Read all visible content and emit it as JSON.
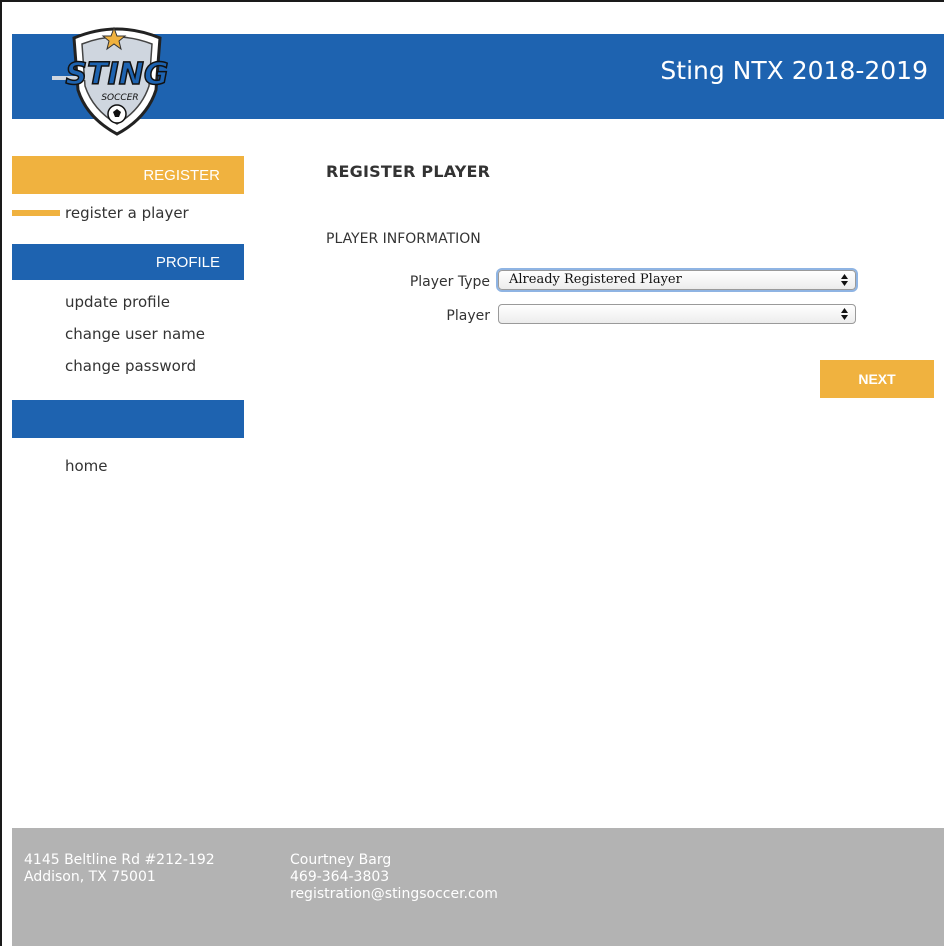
{
  "header": {
    "logo_alt": "Sting Soccer logo",
    "logo_text": "STING",
    "logo_subtext": "SOCCER",
    "site_title": "Sting NTX 2018-2019"
  },
  "sidebar": {
    "register_header": "REGISTER",
    "register_links": [
      "register a player"
    ],
    "profile_header": "PROFILE",
    "profile_links": [
      "update profile",
      "change user name",
      "change password"
    ],
    "blank_header": "",
    "other_links": [
      "home"
    ]
  },
  "main": {
    "page_title": "REGISTER PLAYER",
    "section_title": "PLAYER INFORMATION",
    "fields": [
      {
        "label": "Player Type",
        "value": "Already Registered Player"
      },
      {
        "label": "Player",
        "value": ""
      }
    ],
    "next_label": "NEXT"
  },
  "footer": {
    "address_line1": "4145 Beltline Rd #212-192",
    "address_line2": "Addison, TX 75001",
    "contact_name": "Courtney Barg",
    "contact_phone": "469-364-3803",
    "contact_email": "registration@stingsoccer.com"
  },
  "colors": {
    "brand_blue": "#1e63b0",
    "accent_orange": "#f0b23f",
    "footer_gray": "#b3b3b3"
  }
}
